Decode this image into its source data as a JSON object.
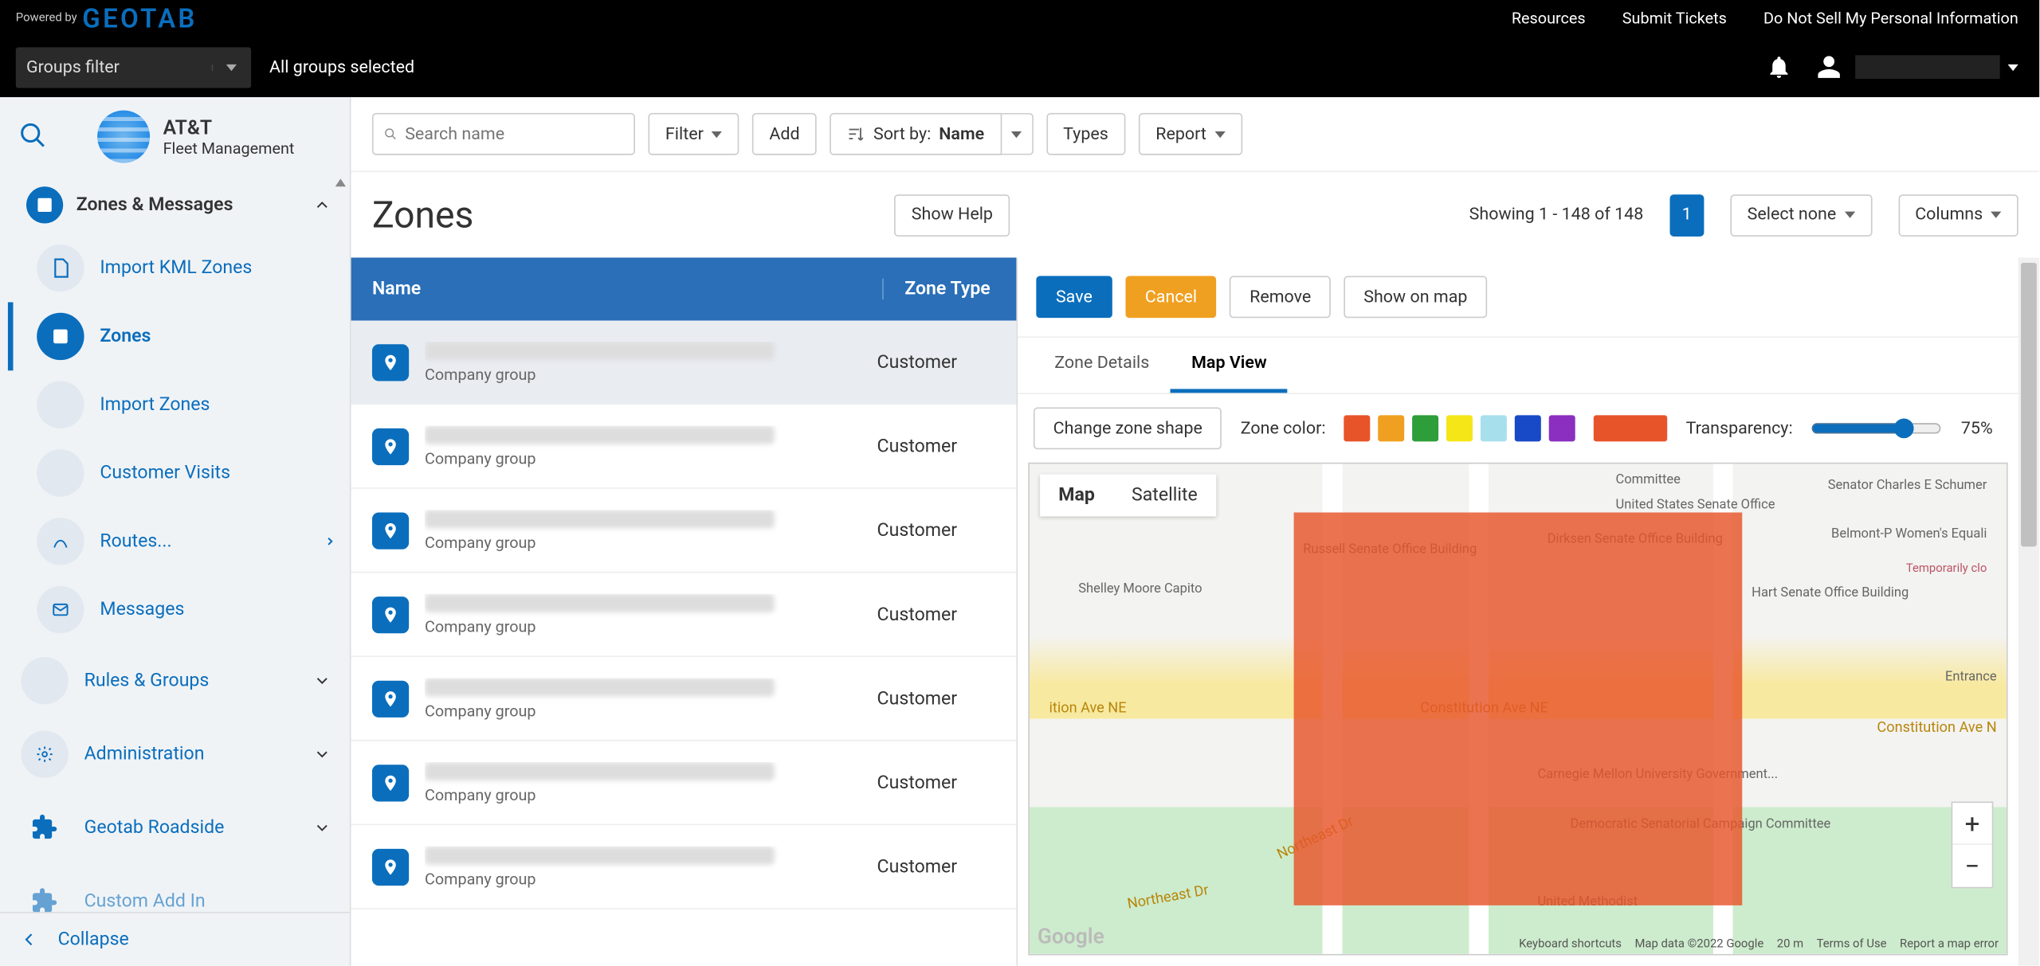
{
  "blackbar": {
    "powered_by": "Powered by",
    "brand": "GEOTAB",
    "links": [
      "Resources",
      "Submit Tickets",
      "Do Not Sell My Personal Information"
    ],
    "groups_filter_label": "Groups filter",
    "all_groups": "All groups selected"
  },
  "brand": {
    "name": "AT&T",
    "subtitle": "Fleet Management"
  },
  "sidebar": {
    "section_title": "Zones & Messages",
    "items": [
      {
        "label": "Import KML Zones",
        "active": false
      },
      {
        "label": "Zones",
        "active": true
      },
      {
        "label": "Import Zones",
        "active": false
      },
      {
        "label": "Customer Visits",
        "active": false
      },
      {
        "label": "Routes...",
        "active": false,
        "hasSubmenu": true
      },
      {
        "label": "Messages",
        "active": false
      }
    ],
    "collapsibles": [
      {
        "label": "Rules & Groups"
      },
      {
        "label": "Administration"
      },
      {
        "label": "Geotab Roadside"
      },
      {
        "label": "Custom Add In"
      }
    ],
    "collapse_label": "Collapse"
  },
  "toolbar": {
    "search_placeholder": "Search name",
    "filter": "Filter",
    "add": "Add",
    "sort_by": "Sort by:",
    "sort_value": "Name",
    "types": "Types",
    "report": "Report"
  },
  "page": {
    "title": "Zones",
    "show_help": "Show Help",
    "showing_text": "Showing 1 - 148 of 148",
    "page_number": "1",
    "select_none": "Select none",
    "columns": "Columns"
  },
  "table": {
    "headers": {
      "name": "Name",
      "type": "Zone Type"
    },
    "sub_label": "Company group",
    "type_value": "Customer",
    "row_count": 7
  },
  "detail": {
    "actions": {
      "save": "Save",
      "cancel": "Cancel",
      "remove": "Remove",
      "show_on_map": "Show on map"
    },
    "tabs": {
      "zone_details": "Zone Details",
      "map_view": "Map View"
    },
    "change_shape": "Change zone shape",
    "zone_color_label": "Zone color:",
    "swatches": [
      "#e8542a",
      "#f0a020",
      "#2e9e3a",
      "#f5e618",
      "#a7e0ec",
      "#1849c6",
      "#8a2fbf"
    ],
    "selected_color": "#e8542a",
    "transparency_label": "Transparency:",
    "transparency_value": "75%"
  },
  "map": {
    "type_toggle": {
      "map": "Map",
      "satellite": "Satellite"
    },
    "streets": [
      "ition Ave NE",
      "Constitution Ave NE",
      "Constitution Ave N",
      "Northeast Dr",
      "Northeast Dr"
    ],
    "pois": [
      "Senator Charles E Schumer",
      "Belmont-P Women's Equali",
      "Temporarily clo",
      "Hart Senate Office Building",
      "Dirksen Senate Office Building",
      "Russell Senate Office Building",
      "Shelley Moore Capito",
      "United States Senate Office",
      "Committee",
      "Carnegie Mellon University Government...",
      "Democratic Senatorial Campaign Committee",
      "United Methodist",
      "Entrance"
    ],
    "attribution": {
      "kb": "Keyboard shortcuts",
      "data": "Map data ©2022 Google",
      "scale": "20 m",
      "terms": "Terms of Use",
      "report": "Report a map error"
    },
    "watermark": "Google"
  }
}
